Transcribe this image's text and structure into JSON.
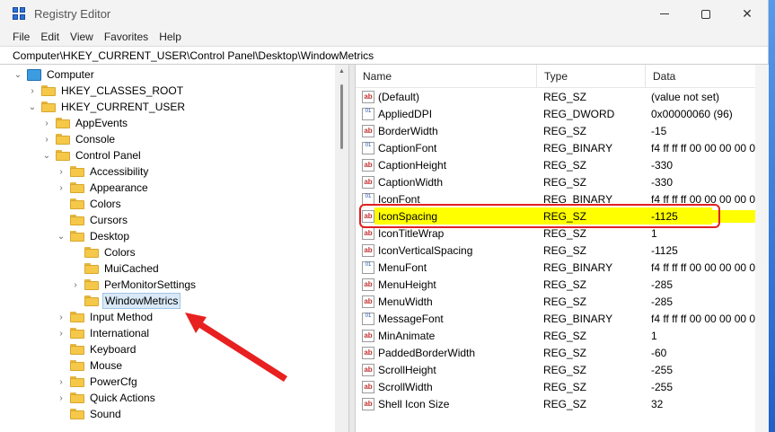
{
  "window": {
    "title": "Registry Editor"
  },
  "menu": [
    "File",
    "Edit",
    "View",
    "Favorites",
    "Help"
  ],
  "address": "Computer\\HKEY_CURRENT_USER\\Control Panel\\Desktop\\WindowMetrics",
  "tree": [
    {
      "label": "Computer",
      "depth": 0,
      "icon": "computer-icon",
      "chevron": "down"
    },
    {
      "label": "HKEY_CLASSES_ROOT",
      "depth": 1,
      "chevron": "right"
    },
    {
      "label": "HKEY_CURRENT_USER",
      "depth": 1,
      "chevron": "down"
    },
    {
      "label": "AppEvents",
      "depth": 2,
      "chevron": "right"
    },
    {
      "label": "Console",
      "depth": 2,
      "chevron": "right"
    },
    {
      "label": "Control Panel",
      "depth": 2,
      "chevron": "down"
    },
    {
      "label": "Accessibility",
      "depth": 3,
      "chevron": "right"
    },
    {
      "label": "Appearance",
      "depth": 3,
      "chevron": "right"
    },
    {
      "label": "Colors",
      "depth": 3,
      "chevron": ""
    },
    {
      "label": "Cursors",
      "depth": 3,
      "chevron": ""
    },
    {
      "label": "Desktop",
      "depth": 3,
      "chevron": "down"
    },
    {
      "label": "Colors",
      "depth": 4,
      "chevron": ""
    },
    {
      "label": "MuiCached",
      "depth": 4,
      "chevron": ""
    },
    {
      "label": "PerMonitorSettings",
      "depth": 4,
      "chevron": "right"
    },
    {
      "label": "WindowMetrics",
      "depth": 4,
      "chevron": "",
      "selected": true
    },
    {
      "label": "Input Method",
      "depth": 3,
      "chevron": "right"
    },
    {
      "label": "International",
      "depth": 3,
      "chevron": "right"
    },
    {
      "label": "Keyboard",
      "depth": 3,
      "chevron": ""
    },
    {
      "label": "Mouse",
      "depth": 3,
      "chevron": ""
    },
    {
      "label": "PowerCfg",
      "depth": 3,
      "chevron": "right"
    },
    {
      "label": "Quick Actions",
      "depth": 3,
      "chevron": "right"
    },
    {
      "label": "Sound",
      "depth": 3,
      "chevron": ""
    }
  ],
  "columns": {
    "name": "Name",
    "type": "Type",
    "data": "Data"
  },
  "values": [
    {
      "name": "(Default)",
      "type": "REG_SZ",
      "data": "(value not set)",
      "icon": "string-value-icon"
    },
    {
      "name": "AppliedDPI",
      "type": "REG_DWORD",
      "data": "0x00000060 (96)",
      "icon": "binary-value-icon"
    },
    {
      "name": "BorderWidth",
      "type": "REG_SZ",
      "data": "-15",
      "icon": "string-value-icon"
    },
    {
      "name": "CaptionFont",
      "type": "REG_BINARY",
      "data": "f4 ff ff ff 00 00 00 00 0",
      "icon": "binary-value-icon"
    },
    {
      "name": "CaptionHeight",
      "type": "REG_SZ",
      "data": "-330",
      "icon": "string-value-icon"
    },
    {
      "name": "CaptionWidth",
      "type": "REG_SZ",
      "data": "-330",
      "icon": "string-value-icon"
    },
    {
      "name": "IconFont",
      "type": "REG_BINARY",
      "data": "f4 ff ff ff 00 00 00 00 0",
      "icon": "binary-value-icon"
    },
    {
      "name": "IconSpacing",
      "type": "REG_SZ",
      "data": "-1125",
      "icon": "string-value-icon",
      "highlighted": true
    },
    {
      "name": "IconTitleWrap",
      "type": "REG_SZ",
      "data": "1",
      "icon": "string-value-icon"
    },
    {
      "name": "IconVerticalSpacing",
      "type": "REG_SZ",
      "data": "-1125",
      "icon": "string-value-icon"
    },
    {
      "name": "MenuFont",
      "type": "REG_BINARY",
      "data": "f4 ff ff ff 00 00 00 00 0",
      "icon": "binary-value-icon"
    },
    {
      "name": "MenuHeight",
      "type": "REG_SZ",
      "data": "-285",
      "icon": "string-value-icon"
    },
    {
      "name": "MenuWidth",
      "type": "REG_SZ",
      "data": "-285",
      "icon": "string-value-icon"
    },
    {
      "name": "MessageFont",
      "type": "REG_BINARY",
      "data": "f4 ff ff ff 00 00 00 00 0",
      "icon": "binary-value-icon"
    },
    {
      "name": "MinAnimate",
      "type": "REG_SZ",
      "data": "1",
      "icon": "string-value-icon"
    },
    {
      "name": "PaddedBorderWidth",
      "type": "REG_SZ",
      "data": "-60",
      "icon": "string-value-icon"
    },
    {
      "name": "ScrollHeight",
      "type": "REG_SZ",
      "data": "-255",
      "icon": "string-value-icon"
    },
    {
      "name": "ScrollWidth",
      "type": "REG_SZ",
      "data": "-255",
      "icon": "string-value-icon"
    },
    {
      "name": "Shell Icon Size",
      "type": "REG_SZ",
      "data": "32",
      "icon": "string-value-icon"
    }
  ],
  "colors": {
    "highlight": "#ffff00",
    "annotation": "#e02020",
    "selection": "#d9e9f7"
  }
}
